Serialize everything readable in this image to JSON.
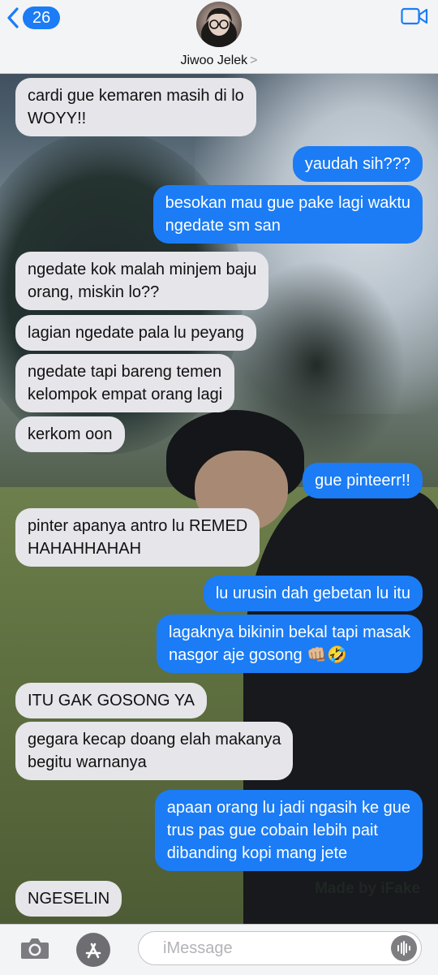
{
  "header": {
    "back_count": "26",
    "contact_name": "Jiwoo Jelek",
    "contact_chevron": ">"
  },
  "messages": [
    {
      "side": "in",
      "text": "cardi gue kemaren masih di lo\nWOYY!!"
    },
    {
      "side": "out",
      "text": "yaudah sih???"
    },
    {
      "side": "out",
      "text": "besokan mau gue pake lagi waktu\nngedate sm san"
    },
    {
      "side": "in",
      "text": "ngedate kok malah minjem baju\norang, miskin lo??"
    },
    {
      "side": "in",
      "text": "lagian ngedate pala lu peyang"
    },
    {
      "side": "in",
      "text": "ngedate tapi bareng temen\nkelompok empat orang lagi"
    },
    {
      "side": "in",
      "text": "kerkom oon"
    },
    {
      "side": "out",
      "text": "gue pinteerr!!"
    },
    {
      "side": "in",
      "text": "pinter apanya antro lu REMED\nHAHAHHAHAH"
    },
    {
      "side": "out",
      "text": "lu urusin dah gebetan lu itu"
    },
    {
      "side": "out",
      "text": "lagaknya bikinin bekal tapi masak\nnasgor aje gosong 👊🏼🤣"
    },
    {
      "side": "in",
      "text": "ITU GAK GOSONG YA"
    },
    {
      "side": "in",
      "text": "gegara kecap doang elah makanya\nbegitu warnanya"
    },
    {
      "side": "out",
      "text": "apaan orang lu jadi ngasih ke gue\ntrus pas gue cobain lebih pait\ndibanding kopi mang jete"
    },
    {
      "side": "in",
      "text": "NGESELIN"
    }
  ],
  "watermark": "Made by iFake",
  "composer": {
    "placeholder": "iMessage"
  },
  "colors": {
    "outgoing": "#1b7cf5",
    "incoming": "#e5e5ea",
    "bar": "#f3f4f6"
  },
  "icons": [
    "chevron-left-icon",
    "video-camera-icon",
    "camera-icon",
    "app-store-icon",
    "audio-waveform-icon"
  ]
}
